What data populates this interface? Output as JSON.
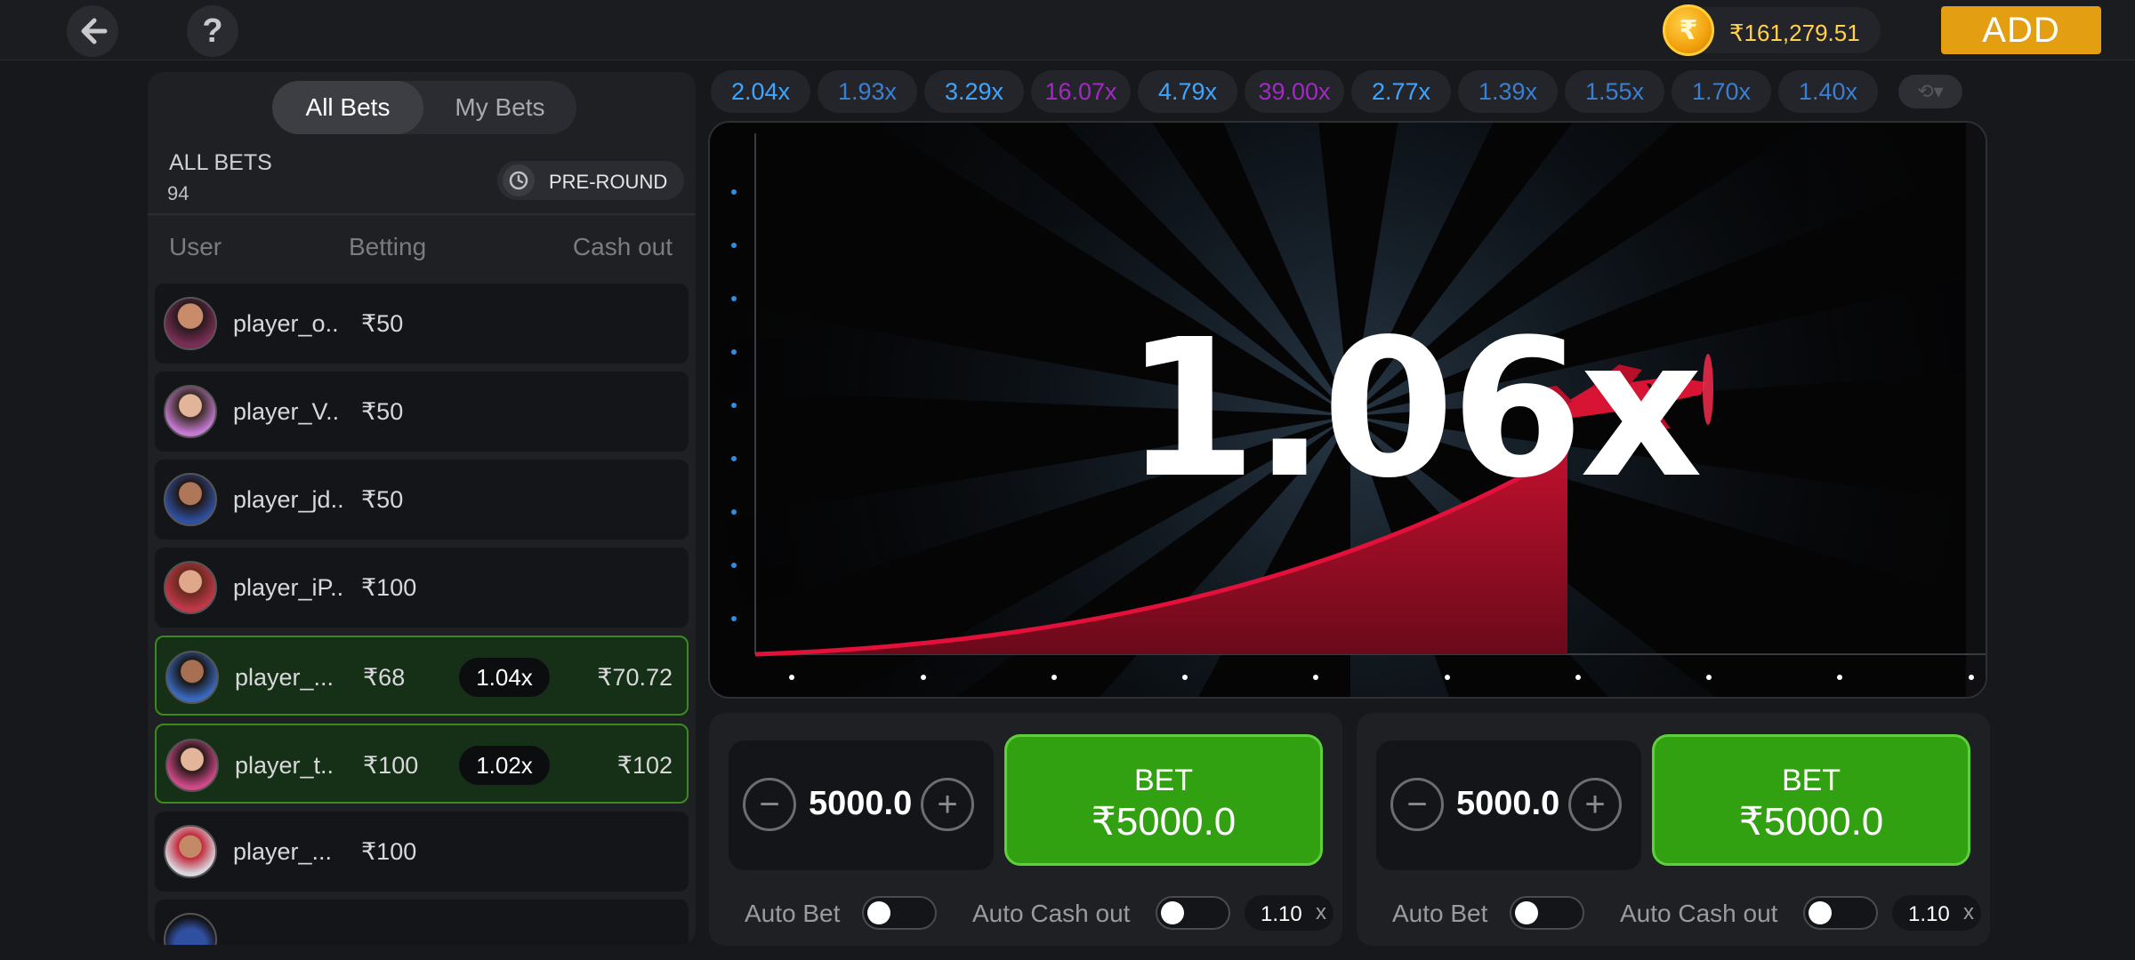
{
  "topbar": {
    "back_icon": "arrow-left-icon",
    "help_icon": "question-icon",
    "coin_symbol": "₹",
    "balance": "₹161,279.51",
    "add_label": "ADD"
  },
  "left_panel": {
    "tabs": [
      {
        "label": "All Bets",
        "active": true
      },
      {
        "label": "My Bets",
        "active": false
      }
    ],
    "all_bets_label": "ALL BETS",
    "all_bets_count": "94",
    "preround_label": "PRE-ROUND",
    "columns": {
      "user": "User",
      "betting": "Betting",
      "cash_out": "Cash out"
    },
    "rows": [
      {
        "player": "player_o..",
        "amount": "₹50",
        "mult": "",
        "cashout": "",
        "win": false
      },
      {
        "player": "player_V..",
        "amount": "₹50",
        "mult": "",
        "cashout": "",
        "win": false
      },
      {
        "player": "player_jd..",
        "amount": "₹50",
        "mult": "",
        "cashout": "",
        "win": false
      },
      {
        "player": "player_iP..",
        "amount": "₹100",
        "mult": "",
        "cashout": "",
        "win": false
      },
      {
        "player": "player_...",
        "amount": "₹68",
        "mult": "1.04x",
        "cashout": "₹70.72",
        "win": true
      },
      {
        "player": "player_t..",
        "amount": "₹100",
        "mult": "1.02x",
        "cashout": "₹102",
        "win": true
      },
      {
        "player": "player_...",
        "amount": "₹100",
        "mult": "",
        "cashout": "",
        "win": false
      }
    ]
  },
  "history": [
    {
      "value": "2.04x",
      "color": "#3ea6ff"
    },
    {
      "value": "1.93x",
      "color": "#3a7fd0"
    },
    {
      "value": "3.29x",
      "color": "#3ea6ff"
    },
    {
      "value": "16.07x",
      "color": "#a229c4"
    },
    {
      "value": "4.79x",
      "color": "#3ea6ff"
    },
    {
      "value": "39.00x",
      "color": "#a229c4"
    },
    {
      "value": "2.77x",
      "color": "#3ea6ff"
    },
    {
      "value": "1.39x",
      "color": "#3a7fd0"
    },
    {
      "value": "1.55x",
      "color": "#3a7fd0"
    },
    {
      "value": "1.70x",
      "color": "#3a7fd0"
    },
    {
      "value": "1.40x",
      "color": "#3a7fd0"
    }
  ],
  "history_more_icon": "history-dropdown-icon",
  "game": {
    "multiplier": "1.06x",
    "plane_icon": "red-plane-icon",
    "curve_color": "#e3103a"
  },
  "bet_panels": [
    {
      "stake": "5000.0",
      "bet_label": "BET",
      "bet_amount": "₹5000.0",
      "auto_bet": "Auto Bet",
      "auto_cashout": "Auto Cash out",
      "cashout_value": "1.10",
      "cashout_x": "x"
    },
    {
      "stake": "5000.0",
      "bet_label": "BET",
      "bet_amount": "₹5000.0",
      "auto_bet": "Auto Bet",
      "auto_cashout": "Auto Cash out",
      "cashout_value": "1.10",
      "cashout_x": "x"
    }
  ]
}
